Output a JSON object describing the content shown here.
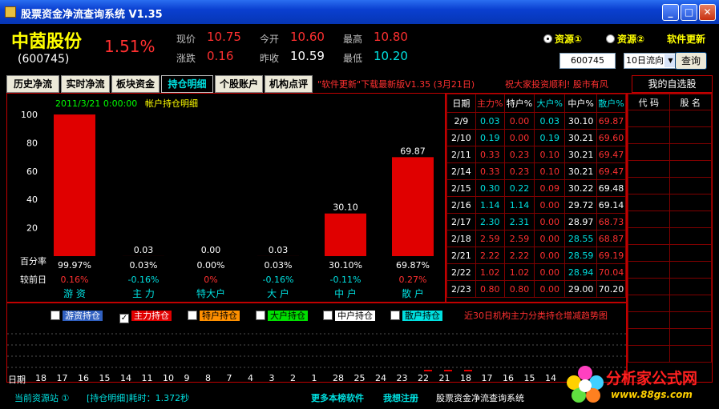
{
  "window": {
    "title": "股票资金净流查询系统  V1.35"
  },
  "stock": {
    "name": "中茵股份",
    "code": "(600745)",
    "pct": "1.51%"
  },
  "quotes": [
    {
      "label": "现价",
      "value": "10.75",
      "color": "red"
    },
    {
      "label": "涨跌",
      "value": "0.16",
      "color": "red"
    },
    {
      "label": "今开",
      "value": "10.60",
      "color": "red"
    },
    {
      "label": "昨收",
      "value": "10.59",
      "color": "white"
    },
    {
      "label": "最高",
      "value": "10.80",
      "color": "red"
    },
    {
      "label": "最低",
      "value": "10.20",
      "color": "cyan"
    }
  ],
  "controls": {
    "source1": "资源①",
    "source2": "资源②",
    "update": "软件更新",
    "code_input": "600745",
    "select_value": "10日流向",
    "query": "查询"
  },
  "tabs": [
    "历史净流",
    "实时净流",
    "板块资金",
    "持仓明细",
    "个股账户",
    "机构点评"
  ],
  "notice": "\"软件更新\"下载最新版V1.35 (3月21日)",
  "notice2": "祝大家投资顺利! 股市有风",
  "watchlist": {
    "title": "我的自选股",
    "col_code": "代 码",
    "col_name": "股 名"
  },
  "chart_data": {
    "type": "bar",
    "title": "2011/3/21 0:00:00",
    "subtitle": "帐户持仓明细",
    "categories": [
      "游 资",
      "主 力",
      "特大户",
      "大 户",
      "中 户",
      "散 户"
    ],
    "values": [
      99.97,
      0.03,
      0.0,
      0.03,
      30.1,
      69.87
    ],
    "value_labels": [
      "",
      "0.03",
      "0.00",
      "0.03",
      "30.10",
      "69.87"
    ],
    "pct_labels": [
      "99.97%",
      "0.03%",
      "0.00%",
      "0.03%",
      "30.10%",
      "69.87%"
    ],
    "changes": [
      "0.16%",
      "-0.16%",
      "0%",
      "-0.16%",
      "-0.11%",
      "0.27%"
    ],
    "change_colors": [
      "#ff3030",
      "#00e0e0",
      "#ff3030",
      "#00e0e0",
      "#00e0e0",
      "#ff3030"
    ],
    "yticks": [
      100,
      80,
      60,
      40,
      20
    ],
    "ylim": [
      0,
      100
    ],
    "row_label1": "百分率",
    "row_label2": "较前日",
    "bar_color": "#e00000"
  },
  "grid": {
    "headers": [
      "日期",
      "主力%",
      "特户%",
      "大户%",
      "中户%",
      "散户%"
    ],
    "header_colors": [
      "#ffffff",
      "#ff3030",
      "#ffffff",
      "#00e0e0",
      "#ffffff",
      "#00e0e0"
    ],
    "rows": [
      [
        "2/9",
        "0.03",
        "0.00",
        "0.03",
        "30.10",
        "69.87"
      ],
      [
        "2/10",
        "0.19",
        "0.00",
        "0.19",
        "30.21",
        "69.60"
      ],
      [
        "2/11",
        "0.33",
        "0.23",
        "0.10",
        "30.21",
        "69.47"
      ],
      [
        "2/14",
        "0.33",
        "0.23",
        "0.10",
        "30.21",
        "69.47"
      ],
      [
        "2/15",
        "0.30",
        "0.22",
        "0.09",
        "30.22",
        "69.48"
      ],
      [
        "2/16",
        "1.14",
        "1.14",
        "0.00",
        "29.72",
        "69.14"
      ],
      [
        "2/17",
        "2.30",
        "2.31",
        "0.00",
        "28.97",
        "68.73"
      ],
      [
        "2/18",
        "2.59",
        "2.59",
        "0.00",
        "28.55",
        "68.87"
      ],
      [
        "2/21",
        "2.22",
        "2.22",
        "0.00",
        "28.59",
        "69.19"
      ],
      [
        "2/22",
        "1.02",
        "1.02",
        "0.00",
        "28.94",
        "70.04"
      ],
      [
        "2/23",
        "0.80",
        "0.80",
        "0.00",
        "29.00",
        "70.20"
      ]
    ],
    "cell_colors": [
      [
        "#ffffff",
        "#00e0e0",
        "#ff3030",
        "#00e0e0",
        "#ffffff",
        "#ff3030"
      ],
      [
        "#ffffff",
        "#00e0e0",
        "#ff3030",
        "#00e0e0",
        "#ffffff",
        "#ff3030"
      ],
      [
        "#ffffff",
        "#ff3030",
        "#ff3030",
        "#ff3030",
        "#ffffff",
        "#ff3030"
      ],
      [
        "#ffffff",
        "#ff3030",
        "#ff3030",
        "#ff3030",
        "#ffffff",
        "#ff3030"
      ],
      [
        "#ffffff",
        "#00e0e0",
        "#00e0e0",
        "#ff3030",
        "#ffffff",
        "#ffffff"
      ],
      [
        "#ffffff",
        "#00e0e0",
        "#00e0e0",
        "#ff3030",
        "#ffffff",
        "#ffffff"
      ],
      [
        "#ffffff",
        "#00e0e0",
        "#00e0e0",
        "#ff3030",
        "#ffffff",
        "#ff3030"
      ],
      [
        "#ffffff",
        "#ff3030",
        "#ff3030",
        "#ff3030",
        "#00e0e0",
        "#ff3030"
      ],
      [
        "#ffffff",
        "#ff3030",
        "#ff3030",
        "#ff3030",
        "#00e0e0",
        "#ff3030"
      ],
      [
        "#ffffff",
        "#ff3030",
        "#ff3030",
        "#ff3030",
        "#00e0e0",
        "#ff3030"
      ],
      [
        "#ffffff",
        "#ff3030",
        "#ff3030",
        "#ff3030",
        "#ffffff",
        "#ffffff"
      ]
    ]
  },
  "lower": {
    "checkboxes": [
      {
        "label": "游资持仓",
        "checked": false,
        "bg": "#3060c0",
        "fg": "#ffffff"
      },
      {
        "label": "主力持仓",
        "checked": true,
        "bg": "#e00000",
        "fg": "#ffffff"
      },
      {
        "label": "特户持仓",
        "checked": false,
        "bg": "#ff9000",
        "fg": "#000000"
      },
      {
        "label": "大户持仓",
        "checked": false,
        "bg": "#00e000",
        "fg": "#000000"
      },
      {
        "label": "中户持仓",
        "checked": false,
        "bg": "#ffffff",
        "fg": "#000000"
      },
      {
        "label": "散户持仓",
        "checked": false,
        "bg": "#00e0e0",
        "fg": "#000000"
      }
    ],
    "trend_label": "近30日机构主力分类持仓增减趋势图",
    "date_label": "日期",
    "dates": [
      "18",
      "17",
      "16",
      "15",
      "14",
      "11",
      "10",
      "9",
      "8",
      "7",
      "4",
      "3",
      "2",
      "1",
      "28",
      "25",
      "24",
      "23",
      "22",
      "21",
      "18",
      "17",
      "16",
      "15",
      "14"
    ]
  },
  "status": {
    "source": "当前资源站 ①",
    "timing": "[持仓明细]耗时：1.372秒",
    "more": "更多本榜软件",
    "register": "我想注册",
    "appname": "股票资金净流查询系统"
  },
  "logo": {
    "brand": "分析家公式网",
    "url": "www.88gs.com"
  }
}
